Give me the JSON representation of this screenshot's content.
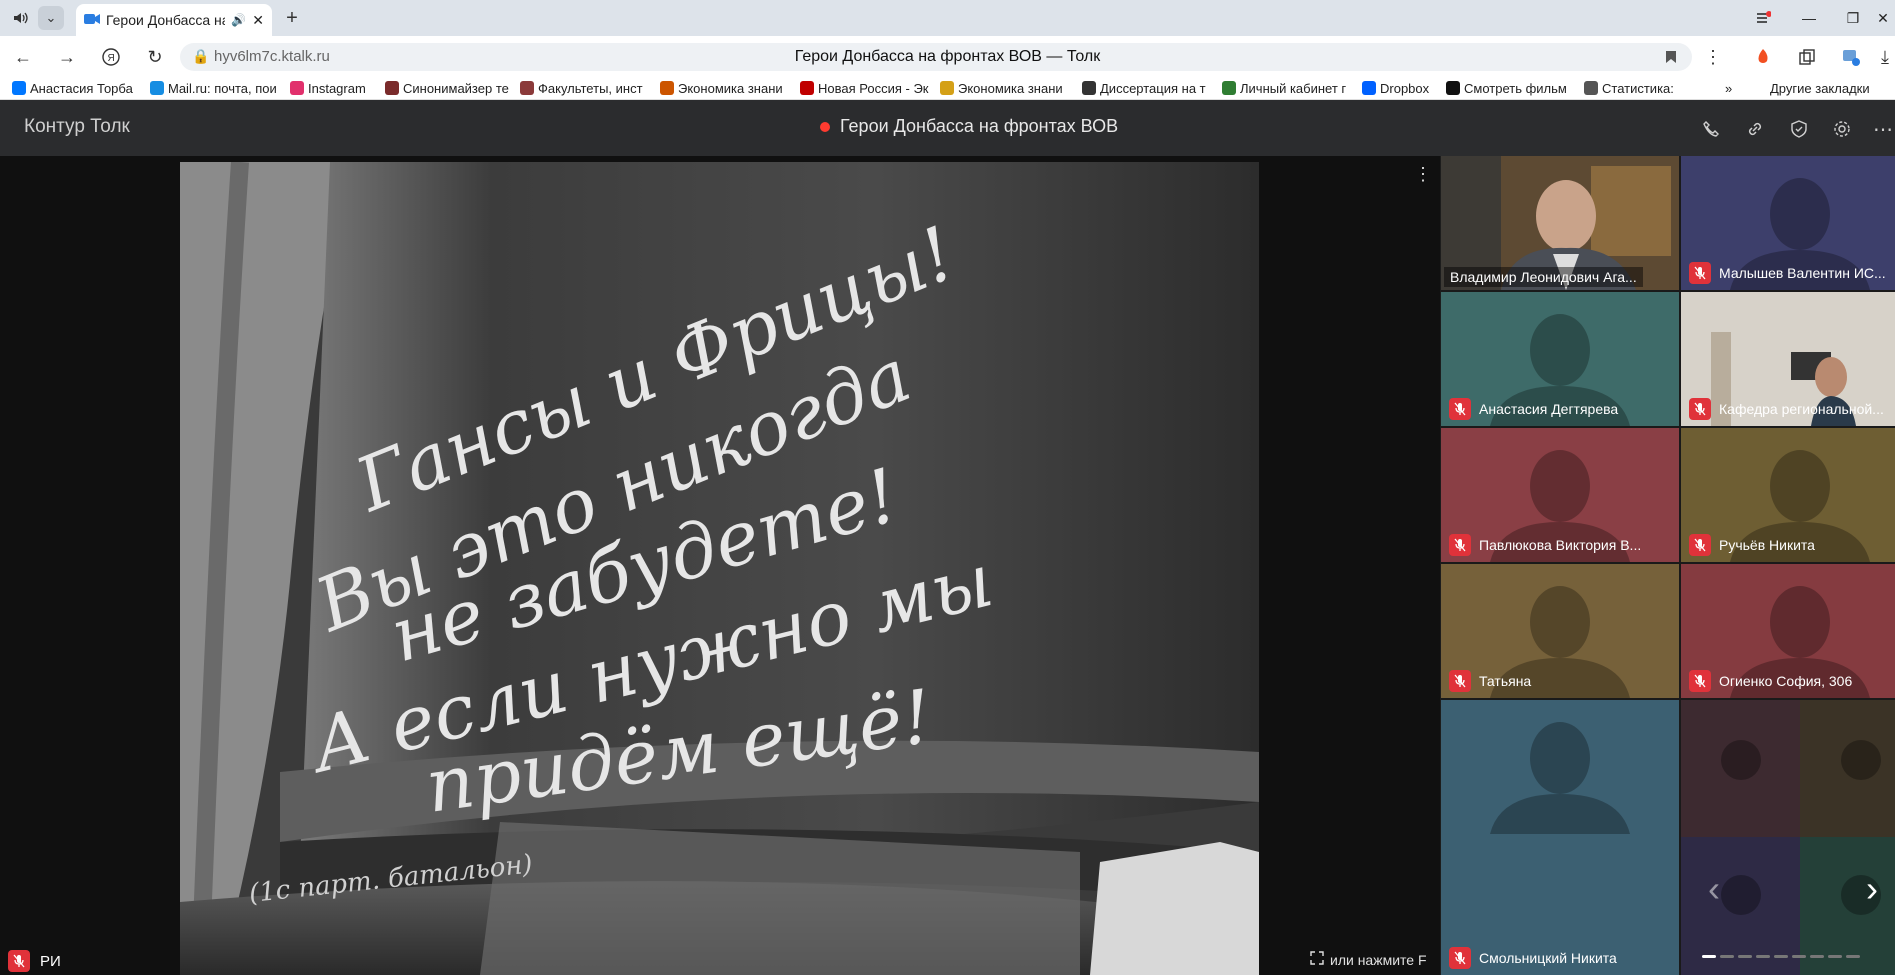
{
  "browser": {
    "tab_title": "Герои Донбасса на ",
    "url": "hyv6lm7c.ktalk.ru",
    "page_title": "Герои Донбасса на фронтах ВОВ — Толк"
  },
  "bookmarks": [
    {
      "label": "Анастасия Торба",
      "icon": "vk-icon",
      "color": "#0077ff"
    },
    {
      "label": "Mail.ru: почта, пои",
      "icon": "mailru-icon",
      "color": "#168de2"
    },
    {
      "label": "Instagram",
      "icon": "instagram-icon",
      "color": "#e1306c"
    },
    {
      "label": "Синонимайзер те",
      "icon": "bookmark-icon",
      "color": "#7a2b2b"
    },
    {
      "label": "Факультеты, инст",
      "icon": "bookmark-icon",
      "color": "#8b3a3a"
    },
    {
      "label": "Экономика знани",
      "icon": "bookmark-icon",
      "color": "#cc5500"
    },
    {
      "label": "Новая Россия - Эк",
      "icon": "hp-icon",
      "color": "#c00000"
    },
    {
      "label": "Экономика знани",
      "icon": "smiley-icon",
      "color": "#d4a017"
    },
    {
      "label": "Диссертация на т",
      "icon": "bookmark-icon",
      "color": "#333333"
    },
    {
      "label": "Личный кабинет г",
      "icon": "bookmark-icon",
      "color": "#2f7d32"
    },
    {
      "label": "Dropbox",
      "icon": "dropbox-icon",
      "color": "#0061ff"
    },
    {
      "label": "Смотреть фильм",
      "icon": "hd-icon",
      "color": "#111111"
    },
    {
      "label": "Статистика:",
      "icon": "bookmark-icon",
      "color": "#555555"
    }
  ],
  "bookmarks_other": "Другие закладки",
  "app": {
    "logo": "Контур Толк",
    "meeting_title": "Герои Донбасса на фронтах ВОВ",
    "fullscreen_hint": "или нажмите F",
    "self_label": "РИ"
  },
  "participants": [
    {
      "name": "Владимир Леонидович Ага...",
      "bg": "#3a4a3a",
      "video": true,
      "active": true,
      "muted": false
    },
    {
      "name": "Малышев Валентин ИС...",
      "bg": "#3d3f6b",
      "video": false,
      "active": false,
      "muted": true
    },
    {
      "name": "Анастасия Дегтярева",
      "bg": "#3e6b69",
      "video": false,
      "active": false,
      "muted": true
    },
    {
      "name": "Кафедра региональной...",
      "bg": "#c8c2b8",
      "video": true,
      "active": false,
      "muted": true
    },
    {
      "name": "Павлюкова Виктория В...",
      "bg": "#8a3f45",
      "video": false,
      "active": false,
      "muted": true
    },
    {
      "name": "Ручьёв Никита",
      "bg": "#6e5e33",
      "video": false,
      "active": false,
      "muted": true
    },
    {
      "name": "Татьяна",
      "bg": "#76613a",
      "video": false,
      "active": false,
      "muted": true
    },
    {
      "name": "Огиенко София, 306",
      "bg": "#853b40",
      "video": false,
      "active": false,
      "muted": true
    },
    {
      "name": "Смольницкий Никита",
      "bg": "#3c6072",
      "video": false,
      "active": false,
      "muted": true
    },
    {
      "name": "",
      "bg": "#3a2a32",
      "video": false,
      "active": false,
      "muted": false
    }
  ]
}
